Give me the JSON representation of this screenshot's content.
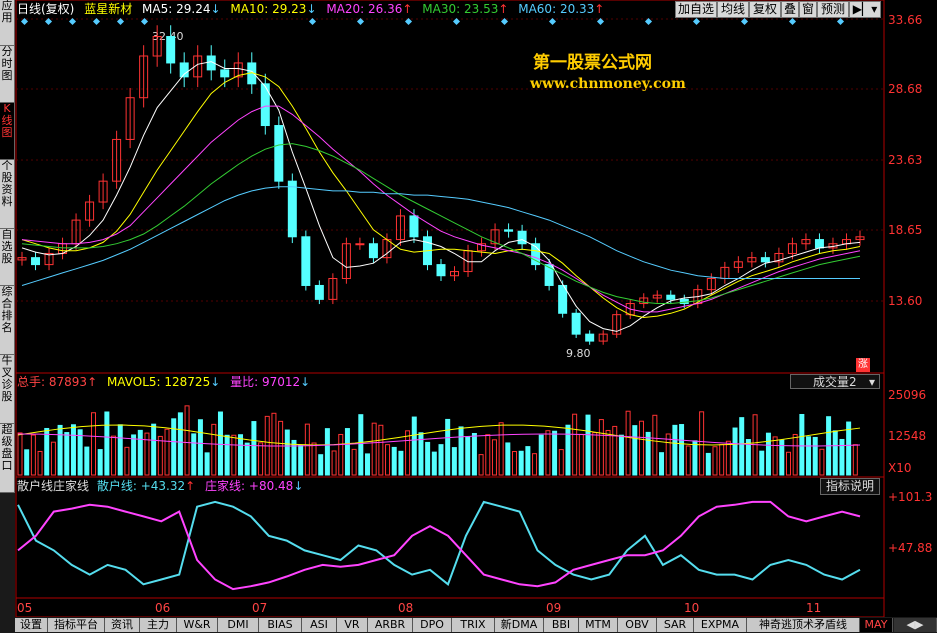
{
  "title": "日线(复权)",
  "stock": "蓝星新材",
  "ma": [
    {
      "label": "MA5:",
      "value": "29.24",
      "arrow": "↓",
      "color": "#ffffff"
    },
    {
      "label": "MA10:",
      "value": "29.23",
      "arrow": "↓",
      "color": "#ffff00"
    },
    {
      "label": "MA20:",
      "value": "26.36",
      "arrow": "↑",
      "color": "#ff44ff"
    },
    {
      "label": "MA30:",
      "value": "23.53",
      "arrow": "↑",
      "color": "#33cc33"
    },
    {
      "label": "MA60:",
      "value": "20.33",
      "arrow": "↑",
      "color": "#55ccff"
    }
  ],
  "toolbar": {
    "watch": "加自选",
    "avg": "均线",
    "restore": "复权",
    "overlay": "叠",
    "window": "窗",
    "predict": "预测"
  },
  "watermark": {
    "line1": "第一股票公式网",
    "line2": "www.chnmoney.com"
  },
  "price_axis": [
    "33.66",
    "28.68",
    "23.63",
    "18.65",
    "13.60"
  ],
  "annot": {
    "high": "32.40",
    "low": "9.80",
    "zhang": "涨"
  },
  "volume": {
    "total_label": "总手:",
    "total": "87893",
    "total_arrow": "↑",
    "mavol_label": "MAVOL5:",
    "mavol": "128725",
    "mavol_arrow": "↓",
    "ratio_label": "量比:",
    "ratio": "97012",
    "ratio_arrow": "↓",
    "dropdown": "成交量2",
    "axis": [
      "25096",
      "12548",
      "X10"
    ]
  },
  "indicator": {
    "name": "散户线庄家线",
    "retail_label": "散户线:",
    "retail": "+43.32",
    "retail_arrow": "↑",
    "dealer_label": "庄家线:",
    "dealer": "+80.48",
    "dealer_arrow": "↓",
    "help": "指标说明",
    "axis": [
      "+101.3",
      "+47.88"
    ]
  },
  "x_axis": [
    "05",
    "06",
    "07",
    "08",
    "09",
    "10",
    "11"
  ],
  "left_tabs": [
    "应用",
    "分时图",
    "K线图",
    "个股资料",
    "自选股",
    "综合排名",
    "牛叉诊股",
    "超级盘口"
  ],
  "bottom_tabs": [
    "设置",
    "指标平台",
    "资讯",
    "主力",
    "W&R",
    "DMI",
    "BIAS",
    "ASI",
    "VR",
    "ARBR",
    "DPO",
    "TRIX",
    "新DMA",
    "BBI",
    "MTM",
    "OBV",
    "SAR",
    "EXPMA",
    "神奇逃顶术矛盾线",
    "MAY"
  ],
  "chart_data": {
    "type": "line",
    "title": "蓝星新材 日线(复权)",
    "xlabel": "",
    "ylabel": "",
    "x_ticks": [
      "05",
      "06",
      "07",
      "08",
      "09",
      "10",
      "11"
    ],
    "ylim": [
      9.5,
      33.66
    ],
    "series": [
      {
        "name": "K线收盘",
        "values": [
          16.5,
          16.0,
          16.8,
          17.5,
          19.2,
          20.5,
          22,
          25,
          28,
          31,
          32.4,
          30.5,
          29.5,
          31,
          30,
          29.5,
          30.5,
          29,
          26,
          22,
          18,
          14.5,
          13.5,
          15,
          17.5,
          17.5,
          16.5,
          17.8,
          19.5,
          18,
          16,
          15.2,
          15.5,
          17,
          17.5,
          18.5,
          18.4,
          17.5,
          16,
          14.5,
          12.5,
          11,
          10.5,
          11,
          12.4,
          13.2,
          13.6,
          13.8,
          13.5,
          13.2,
          14.2,
          15,
          15.8,
          16.2,
          16.5,
          16.2,
          16.8,
          17.5,
          17.8,
          17.2,
          17.5,
          17.8,
          18
        ]
      },
      {
        "name": "MA5",
        "values": [
          17.2,
          16.9,
          16.7,
          16.8,
          17.3,
          18.1,
          19.2,
          21,
          23,
          25.3,
          27.3,
          28.5,
          29.7,
          30.4,
          30.6,
          30.1,
          30.1,
          29.9,
          28.8,
          27.1,
          24.1,
          21.5,
          18.8,
          16.5,
          15.8,
          15.9,
          16.1,
          16.8,
          17.6,
          17.8,
          17.6,
          17.3,
          16.8,
          16.2,
          16.2,
          17,
          17.6,
          17.8,
          17.3,
          16.3,
          14.6,
          13,
          11.9,
          11.4,
          11.2,
          11.6,
          12.3,
          12.9,
          13.4,
          13.6,
          13.7,
          13.9,
          14.5,
          15,
          15.6,
          16.1,
          16.3,
          16.6,
          16.9,
          17.2,
          17.3,
          17.5,
          17.6
        ]
      },
      {
        "name": "MA10",
        "values": [
          17.8,
          17.5,
          17.2,
          17,
          17,
          17.2,
          17.6,
          18.4,
          19.6,
          21.2,
          22.8,
          24.2,
          25.6,
          27,
          28.3,
          29.1,
          29.6,
          29.8,
          29.5,
          28.8,
          27.4,
          25.8,
          24.1,
          22.6,
          21.3,
          19.9,
          18.5,
          17.8,
          17.1,
          16.9,
          17,
          17.1,
          17.1,
          17,
          16.9,
          16.8,
          17,
          17.1,
          17,
          16.8,
          16.1,
          15.2,
          14.4,
          13.6,
          12.9,
          12.4,
          12.2,
          12.3,
          12.5,
          12.8,
          13.3,
          13.8,
          14.3,
          14.8,
          15.2,
          15.5,
          15.8,
          16.2,
          16.5,
          16.8,
          17,
          17.1,
          17.3
        ]
      },
      {
        "name": "MA20",
        "values": [
          17.8,
          17.7,
          17.6,
          17.5,
          17.5,
          17.6,
          17.8,
          18.2,
          18.8,
          19.8,
          20.8,
          21.8,
          22.8,
          23.8,
          24.8,
          25.6,
          26.4,
          27,
          27.4,
          27.4,
          26.8,
          26,
          25.2,
          24.3,
          23.5,
          22.7,
          21.8,
          21,
          20.3,
          19.6,
          19,
          18.4,
          18,
          17.7,
          17.4,
          17.2,
          17,
          16.8,
          16.5,
          16.1,
          15.6,
          15,
          14.4,
          13.8,
          13.3,
          12.8,
          12.6,
          12.6,
          12.8,
          13,
          13.2,
          13.5,
          13.9,
          14.3,
          14.7,
          15.1,
          15.5,
          15.8,
          16.1,
          16.4,
          16.6,
          16.8,
          17
        ]
      },
      {
        "name": "MA30",
        "values": [
          17.5,
          17.4,
          17.3,
          17.2,
          17.2,
          17.2,
          17.3,
          17.5,
          17.8,
          18.2,
          18.8,
          19.5,
          20.2,
          21,
          21.8,
          22.5,
          23.2,
          23.8,
          24.3,
          24.6,
          24.7,
          24.5,
          24.2,
          23.8,
          23.3,
          22.8,
          22.2,
          21.6,
          21,
          20.5,
          20,
          19.5,
          19,
          18.5,
          18,
          17.6,
          17.2,
          16.8,
          16.3,
          15.8,
          15.3,
          14.8,
          14.4,
          14,
          13.7,
          13.5,
          13.3,
          13.2,
          13.2,
          13.3,
          13.4,
          13.6,
          13.9,
          14.2,
          14.5,
          14.8,
          15.1,
          15.4,
          15.7,
          16,
          16.2,
          16.4,
          16.6
        ]
      },
      {
        "name": "MA60",
        "values": [
          14.5,
          14.8,
          15.1,
          15.4,
          15.7,
          16,
          16.3,
          16.7,
          17.1,
          17.6,
          18.1,
          18.6,
          19.1,
          19.6,
          20.1,
          20.6,
          21,
          21.3,
          21.5,
          21.6,
          21.6,
          21.5,
          21.4,
          21.3,
          21.3,
          21.2,
          21.2,
          21.1,
          21.1,
          21,
          21,
          20.9,
          20.8,
          20.7,
          20.5,
          20.3,
          20.1,
          19.8,
          19.5,
          19.2,
          18.8,
          18.4,
          18,
          17.5,
          17,
          16.6,
          16.2,
          15.9,
          15.6,
          15.4,
          15.2,
          15.1,
          15,
          15,
          15,
          15,
          15,
          15,
          15,
          15,
          15,
          15,
          15
        ]
      }
    ]
  }
}
